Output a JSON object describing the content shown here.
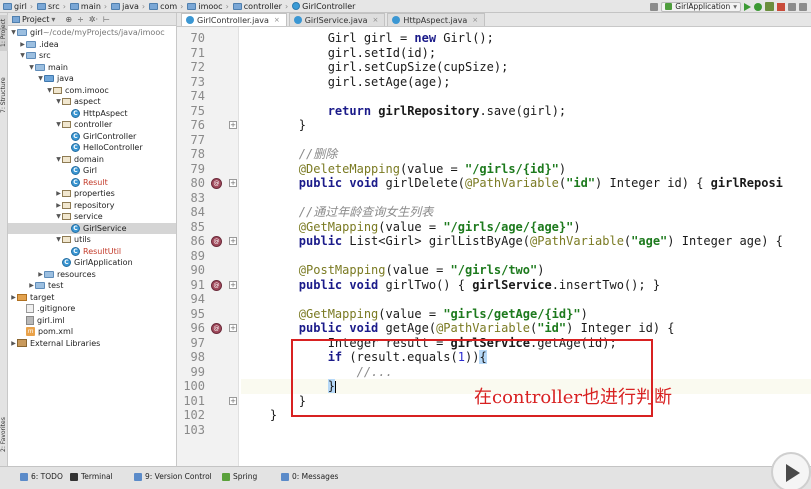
{
  "breadcrumb": [
    "girl",
    "src",
    "main",
    "java",
    "com",
    "imooc",
    "controller",
    "GirlController"
  ],
  "run_config": "GirlApplication",
  "left_strip_tabs": [
    "1: Project",
    "7: Structure",
    "2: Favorites"
  ],
  "project_panel": {
    "title": "Project",
    "tools": [
      "⊕",
      "÷",
      "✲·",
      "⊢"
    ]
  },
  "tree": [
    {
      "label": "girl",
      "suffix": " ~/code/myProjects/java/imooc",
      "depth": 0,
      "icon": "folder",
      "arrow": "down"
    },
    {
      "label": ".idea",
      "depth": 1,
      "icon": "folder",
      "arrow": "right"
    },
    {
      "label": "src",
      "depth": 1,
      "icon": "folder",
      "arrow": "down"
    },
    {
      "label": "main",
      "depth": 2,
      "icon": "folder",
      "arrow": "down"
    },
    {
      "label": "java",
      "depth": 3,
      "icon": "srcfolder",
      "arrow": "down"
    },
    {
      "label": "com.imooc",
      "depth": 4,
      "icon": "pkg",
      "arrow": "down"
    },
    {
      "label": "aspect",
      "depth": 5,
      "icon": "pkg",
      "arrow": "down"
    },
    {
      "label": "HttpAspect",
      "depth": 6,
      "icon": "cls",
      "arrow": ""
    },
    {
      "label": "controller",
      "depth": 5,
      "icon": "pkg",
      "arrow": "down"
    },
    {
      "label": "GirlController",
      "depth": 6,
      "icon": "cls",
      "arrow": ""
    },
    {
      "label": "HelloController",
      "depth": 6,
      "icon": "cls",
      "arrow": ""
    },
    {
      "label": "domain",
      "depth": 5,
      "icon": "pkg",
      "arrow": "down"
    },
    {
      "label": "Girl",
      "depth": 6,
      "icon": "cls",
      "arrow": ""
    },
    {
      "label": "Result",
      "depth": 6,
      "icon": "cls",
      "arrow": "",
      "color": "red"
    },
    {
      "label": "properties",
      "depth": 5,
      "icon": "pkg",
      "arrow": "right"
    },
    {
      "label": "repository",
      "depth": 5,
      "icon": "pkg",
      "arrow": "right"
    },
    {
      "label": "service",
      "depth": 5,
      "icon": "pkg",
      "arrow": "down"
    },
    {
      "label": "GirlService",
      "depth": 6,
      "icon": "cls",
      "arrow": "",
      "selected": true
    },
    {
      "label": "utils",
      "depth": 5,
      "icon": "pkg",
      "arrow": "down"
    },
    {
      "label": "ResultUtil",
      "depth": 6,
      "icon": "cls",
      "arrow": "",
      "color": "red"
    },
    {
      "label": "GirlApplication",
      "depth": 5,
      "icon": "cls",
      "arrow": ""
    },
    {
      "label": "resources",
      "depth": 3,
      "icon": "folder",
      "arrow": "right"
    },
    {
      "label": "test",
      "depth": 2,
      "icon": "folder",
      "arrow": "right"
    },
    {
      "label": "target",
      "depth": 0,
      "icon": "exc",
      "arrow": "right"
    },
    {
      "label": ".gitignore",
      "depth": 1,
      "icon": "file",
      "arrow": ""
    },
    {
      "label": "girl.iml",
      "depth": 1,
      "icon": "iml",
      "arrow": ""
    },
    {
      "label": "pom.xml",
      "depth": 1,
      "icon": "xml",
      "arrow": ""
    },
    {
      "label": "External Libraries",
      "depth": 0,
      "icon": "lib",
      "arrow": "right"
    }
  ],
  "tabs": [
    {
      "label": "GirlController.java",
      "active": true
    },
    {
      "label": "GirlService.java",
      "active": false
    },
    {
      "label": "HttpAspect.java",
      "active": false
    }
  ],
  "editor": {
    "lines": [
      {
        "n": "70",
        "html": "            Girl girl = <span class='kw'>new</span> Girl();"
      },
      {
        "n": "71",
        "html": "            girl.setId(id);"
      },
      {
        "n": "72",
        "html": "            girl.setCupSize(cupSize);"
      },
      {
        "n": "73",
        "html": "            girl.setAge(age);"
      },
      {
        "n": "74",
        "html": ""
      },
      {
        "n": "75",
        "html": "            <span class='kw'>return</span> <span class='bold'>girlRepository</span>.save(girl);"
      },
      {
        "n": "76",
        "html": "        }",
        "fold": true
      },
      {
        "n": "77",
        "html": ""
      },
      {
        "n": "78",
        "html": "        <span class='cm'>//删除</span>"
      },
      {
        "n": "79",
        "html": "        <span class='ann'>@DeleteMapping</span>(value = <span class='str'>\"/girls/{id}\"</span>)"
      },
      {
        "n": "80",
        "html": "        <span class='kw'>public void</span> girlDelete(<span class='ann'>@PathVariable</span>(<span class='str'>\"id\"</span>) Integer id) { <span class='bold'>girlReposi</span>",
        "mark": true,
        "fold": true
      },
      {
        "n": "83",
        "html": ""
      },
      {
        "n": "84",
        "html": "        <span class='cm'>//通过年龄查询女生列表</span>"
      },
      {
        "n": "85",
        "html": "        <span class='ann'>@GetMapping</span>(value = <span class='str'>\"/girls/age/{age}\"</span>)"
      },
      {
        "n": "86",
        "html": "        <span class='kw'>public</span> List&lt;Girl&gt; girlListByAge(<span class='ann'>@PathVariable</span>(<span class='str'>\"age\"</span>) Integer age) {",
        "mark": true,
        "fold": true
      },
      {
        "n": "89",
        "html": ""
      },
      {
        "n": "90",
        "html": "        <span class='ann'>@PostMapping</span>(value = <span class='str'>\"/girls/two\"</span>)"
      },
      {
        "n": "91",
        "html": "        <span class='kw'>public void</span> girlTwo() { <span class='bold'>girlService</span>.insertTwo(); }",
        "mark": true,
        "fold": true
      },
      {
        "n": "94",
        "html": ""
      },
      {
        "n": "95",
        "html": "        <span class='ann'>@GetMapping</span>(value = <span class='str'>\"girls/getAge/{id}\"</span>)"
      },
      {
        "n": "96",
        "html": "        <span class='kw'>public void</span> getAge(<span class='ann'>@PathVariable</span>(<span class='str'>\"id\"</span>) Integer id) {",
        "mark": true,
        "fold": true
      },
      {
        "n": "97",
        "html": "            Integer result = <span class='bold'>girlService</span>.getAge(id);"
      },
      {
        "n": "98",
        "html": "            <span class='kw'>if</span> (result.equals(<span class='num-lit'>1</span>))<span class='brace-hl'>{</span>"
      },
      {
        "n": "99",
        "html": "                <span class='cm'>//...</span>"
      },
      {
        "n": "100",
        "html": "            <span class='brace-hl'>}</span><span class='caret'></span>",
        "current": true
      },
      {
        "n": "101",
        "html": "        }",
        "fold": true
      },
      {
        "n": "102",
        "html": "    }"
      },
      {
        "n": "103",
        "html": ""
      }
    ],
    "callout_text": "在controller也进行判断"
  },
  "bottom_tools": [
    {
      "label": "6: TODO",
      "color": "#5b8bc9"
    },
    {
      "label": "Terminal",
      "color": "#333333"
    },
    {
      "label": "9: Version Control",
      "color": "#5b8bc9"
    },
    {
      "label": "Spring",
      "color": "#5aa13b"
    },
    {
      "label": "0: Messages",
      "color": "#5b8bc9"
    }
  ]
}
